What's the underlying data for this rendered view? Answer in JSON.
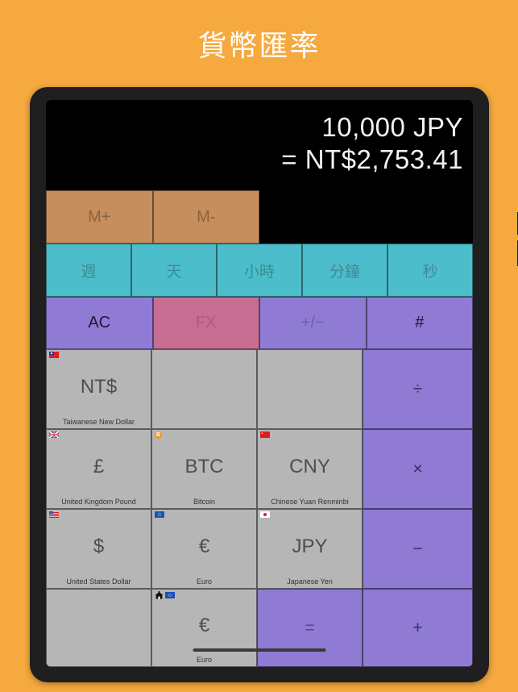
{
  "page": {
    "title": "貨幣匯率",
    "background_color": "#f5a93e",
    "title_color": "#ffffff"
  },
  "device": {
    "bezel_color": "#1f1f1f",
    "screen_color": "#000000"
  },
  "display": {
    "input_amount": "10,000 JPY",
    "result_amount": "= NT$2,753.41"
  },
  "memory_row": {
    "color": "#c68e5c",
    "buttons": [
      {
        "label": "M+",
        "name": "memory-add-button"
      },
      {
        "label": "M-",
        "name": "memory-subtract-button"
      }
    ]
  },
  "time_row": {
    "color": "#4cbdca",
    "buttons": [
      {
        "label": "週",
        "name": "time-week-button"
      },
      {
        "label": "天",
        "name": "time-day-button"
      },
      {
        "label": "小時",
        "name": "time-hour-button"
      },
      {
        "label": "分鐘",
        "name": "time-minute-button"
      },
      {
        "label": "秒",
        "name": "time-second-button"
      }
    ]
  },
  "function_row": {
    "color": "#8f7ad4",
    "fx_color": "#c76e92",
    "buttons": [
      {
        "label": "AC",
        "name": "all-clear-button",
        "style": "normal"
      },
      {
        "label": "FX",
        "name": "fx-button",
        "style": "fx"
      },
      {
        "label": "+/−",
        "name": "sign-toggle-button",
        "style": "muted"
      },
      {
        "label": "#",
        "name": "hash-button",
        "style": "normal"
      }
    ]
  },
  "currency_grid": {
    "cell_color": "#b6b6b6",
    "operator_color": "#8f7ad4",
    "rows": [
      {
        "cells": [
          {
            "type": "currency",
            "symbol": "NT$",
            "name_label": "Taiwanese New Dollar",
            "badge": "tw-flag",
            "name": "currency-cell-twd"
          },
          {
            "type": "empty",
            "name": "currency-cell-empty-1"
          },
          {
            "type": "empty",
            "name": "currency-cell-empty-2"
          },
          {
            "type": "operator",
            "symbol": "÷",
            "name": "divide-button"
          }
        ]
      },
      {
        "cells": [
          {
            "type": "currency",
            "symbol": "£",
            "name_label": "United Kingdom Pound",
            "badge": "gb-flag",
            "name": "currency-cell-gbp"
          },
          {
            "type": "currency",
            "symbol": "BTC",
            "name_label": "Bitcoin",
            "badge": "btc-icon",
            "name": "currency-cell-btc"
          },
          {
            "type": "currency",
            "symbol": "CNY",
            "name_label": "Chinese Yuan Renminbi",
            "badge": "cn-flag",
            "name": "currency-cell-cny"
          },
          {
            "type": "operator",
            "symbol": "×",
            "name": "multiply-button"
          }
        ]
      },
      {
        "cells": [
          {
            "type": "currency",
            "symbol": "$",
            "name_label": "United States Dollar",
            "badge": "us-flag",
            "name": "currency-cell-usd"
          },
          {
            "type": "currency",
            "symbol": "€",
            "name_label": "Euro",
            "badge": "eu-flag",
            "name": "currency-cell-eur"
          },
          {
            "type": "currency",
            "symbol": "JPY",
            "name_label": "Japanese Yen",
            "badge": "jp-flag",
            "name": "currency-cell-jpy"
          },
          {
            "type": "operator",
            "symbol": "−",
            "name": "subtract-button"
          }
        ]
      },
      {
        "cells": [
          {
            "type": "empty",
            "name": "currency-cell-empty-3"
          },
          {
            "type": "currency",
            "symbol": "€",
            "name_label": "Euro",
            "badge": "home-eu",
            "name": "currency-cell-eur-home"
          },
          {
            "type": "equals",
            "symbol": "=",
            "name": "equals-button"
          },
          {
            "type": "operator",
            "symbol": "+",
            "name": "add-button"
          }
        ]
      }
    ]
  }
}
